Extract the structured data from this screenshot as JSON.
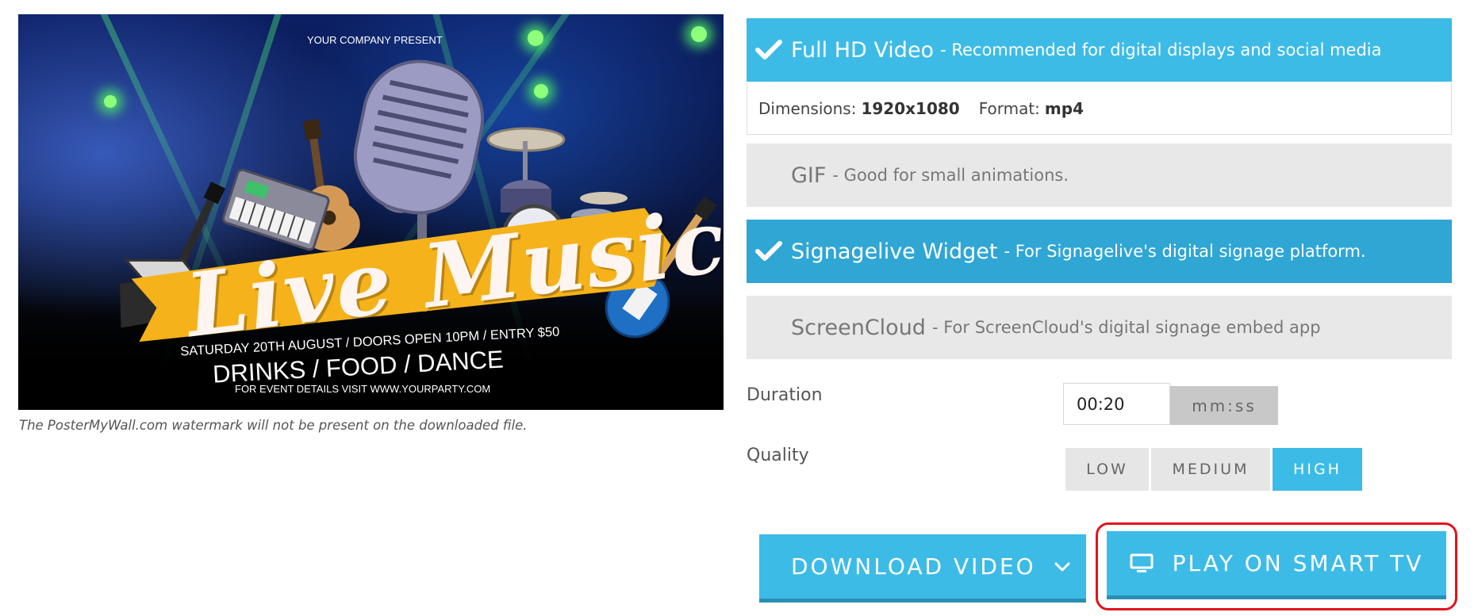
{
  "preview": {
    "top_line": "YOUR COMPANY PRESENT",
    "title": "Live Music",
    "date_line": "SATURDAY 20TH AUGUST / DOORS OPEN 10PM  / ENTRY $50",
    "offer_line": "DRINKS  / FOOD / DANCE",
    "details_line": "FOR EVENT DETAILS VISIT WWW.YOURPARTY.COM",
    "note": "The PosterMyWall.com watermark will not be present on the downloaded file."
  },
  "formats": [
    {
      "name": "Full HD Video",
      "desc": "- Recommended for digital displays and social media",
      "selected": true,
      "icon": "checkmark-icon"
    },
    {
      "name": "GIF",
      "desc": "- Good for small animations.",
      "selected": false
    },
    {
      "name": "Signagelive Widget",
      "desc": "- For Signagelive's digital signage platform.",
      "selected": true,
      "icon": "checkmark-icon"
    },
    {
      "name": "ScreenCloud",
      "desc": "- For ScreenCloud's digital signage embed app",
      "selected": false
    }
  ],
  "dimensions": {
    "dim_label": "Dimensions:",
    "dim_value": "1920x1080",
    "format_label": "Format:",
    "format_value": "mp4"
  },
  "duration": {
    "label": "Duration",
    "value": "00:20",
    "unit": "mm:ss"
  },
  "quality": {
    "label": "Quality",
    "options": [
      "LOW",
      "MEDIUM",
      "HIGH"
    ],
    "selected": "HIGH"
  },
  "actions": {
    "download_label": "DOWNLOAD VIDEO",
    "download_icon": "chevron-down-icon",
    "tv_label": "PLAY ON SMART TV",
    "tv_icon": "monitor-icon"
  },
  "colors": {
    "accent": "#3dbbe7",
    "accent_dark": "#2fa6d4",
    "highlight_frame": "#e0141c",
    "poster_ribbon": "#f6b21a"
  }
}
